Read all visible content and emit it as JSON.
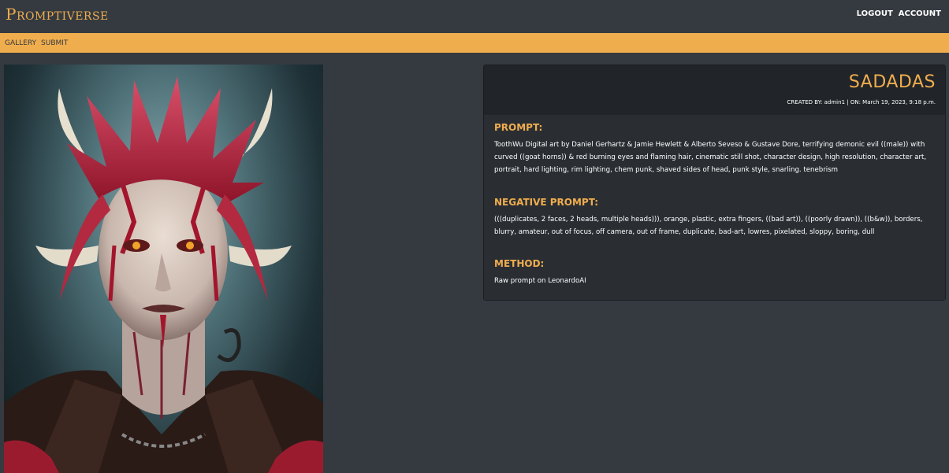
{
  "header": {
    "brand": "Promptiverse",
    "nav": [
      "LOGOUT",
      "ACCOUNT"
    ]
  },
  "subnav": {
    "items": [
      "GALLERY",
      "SUBMIT"
    ]
  },
  "post": {
    "title": "SADADAS",
    "meta": "CREATED BY: admin1 | ON: March 19, 2023, 9:18 p.m.",
    "sections": [
      {
        "heading": "PROMPT:",
        "text": "ToothWu Digital art by Daniel Gerhartz & Jamie Hewlett & Alberto Seveso & Gustave Dore, terrifying demonic evil ((male)) with curved ((goat horns)) & red burning eyes and flaming hair, cinematic still shot, character design, high resolution, character art, portrait, hard lighting, rim lighting, chem punk, shaved sides of head, punk style, snarling. tenebrism"
      },
      {
        "heading": "NEGATIVE PROMPT:",
        "text": "(((duplicates, 2 faces, 2 heads, multiple heads))), orange, plastic, extra fingers, ((bad art)), ((poorly drawn)), ((b&w)), borders, blurry, amateur, out of focus, off camera, out of frame, duplicate, bad-art, lowres, pixelated, sloppy, boring, dull"
      },
      {
        "heading": "METHOD:",
        "text": "Raw prompt on LeonardoAI"
      }
    ]
  },
  "colors": {
    "background": "#343a40",
    "accent": "#f0ad4e",
    "card": "#212529",
    "card_body": "#2a2e33"
  }
}
